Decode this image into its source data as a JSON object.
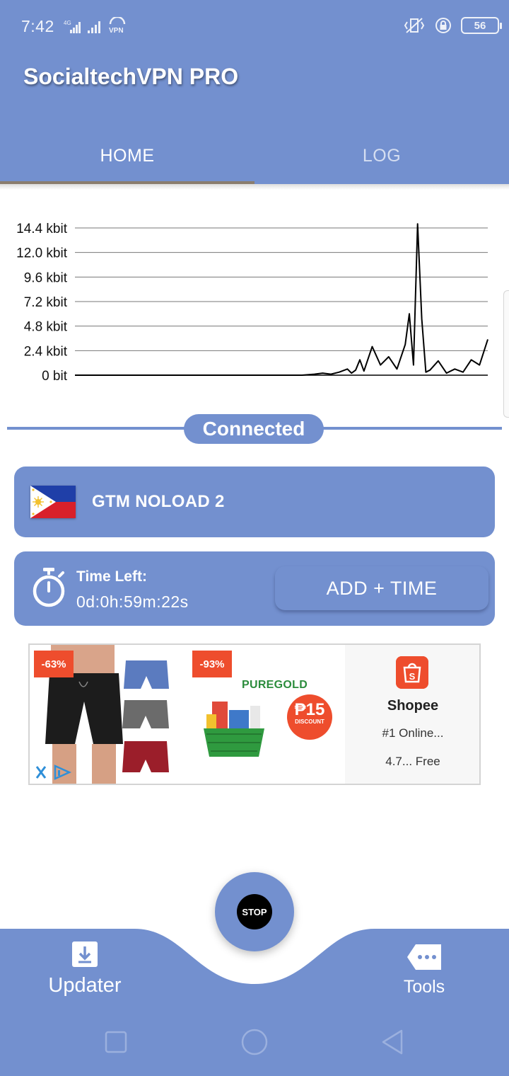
{
  "status_bar": {
    "time": "7:42",
    "network_type": "4G",
    "vpn_label": "VPN",
    "battery": "56"
  },
  "app": {
    "title": "SocialtechVPN PRO"
  },
  "tabs": [
    {
      "label": "HOME",
      "active": true
    },
    {
      "label": "LOG",
      "active": false
    }
  ],
  "chart_data": {
    "type": "line",
    "y_tick_labels": [
      "14.4 kbit",
      "12.0 kbit",
      "9.6 kbit",
      "7.2 kbit",
      "4.8 kbit",
      "2.4 kbit",
      "0 bit"
    ],
    "ylim": [
      0,
      14.4
    ],
    "y_unit": "kbit",
    "grid": true,
    "x": [
      0,
      10,
      20,
      30,
      40,
      50,
      55,
      58,
      60,
      62,
      64,
      66,
      67,
      68,
      69,
      70,
      72,
      74,
      76,
      78,
      80,
      81,
      82,
      83,
      84,
      85,
      86,
      88,
      90,
      92,
      94,
      96,
      98,
      100
    ],
    "values": [
      0,
      0,
      0,
      0,
      0,
      0,
      0,
      0.1,
      0.2,
      0.1,
      0.3,
      0.6,
      0.2,
      0.5,
      1.5,
      0.4,
      2.8,
      1.0,
      1.8,
      0.6,
      3.0,
      6.0,
      1.0,
      14.8,
      5.5,
      0.3,
      0.5,
      1.4,
      0.2,
      0.6,
      0.3,
      1.5,
      1.0,
      3.5
    ]
  },
  "connection": {
    "status": "Connected"
  },
  "server": {
    "name": "GTM NOLOAD 2",
    "flag": "philippines-flag"
  },
  "timer": {
    "label": "Time Left:",
    "value": "0d:0h:59m:22s",
    "button_label": "ADD + TIME"
  },
  "ad": {
    "badge1": "-63%",
    "badge2": "-93%",
    "store_name": "PUREGOLD",
    "discount_value": "₱15",
    "discount_label": "DISCOUNT",
    "brand": "Shopee",
    "line1": "#1 Online...",
    "line2": "4.7... Free"
  },
  "stop_button": {
    "label": "STOP"
  },
  "bottom_nav": {
    "left_label": "Updater",
    "right_label": "Tools"
  },
  "colors": {
    "primary": "#7390cf",
    "accent_orange": "#ee4d2d"
  }
}
